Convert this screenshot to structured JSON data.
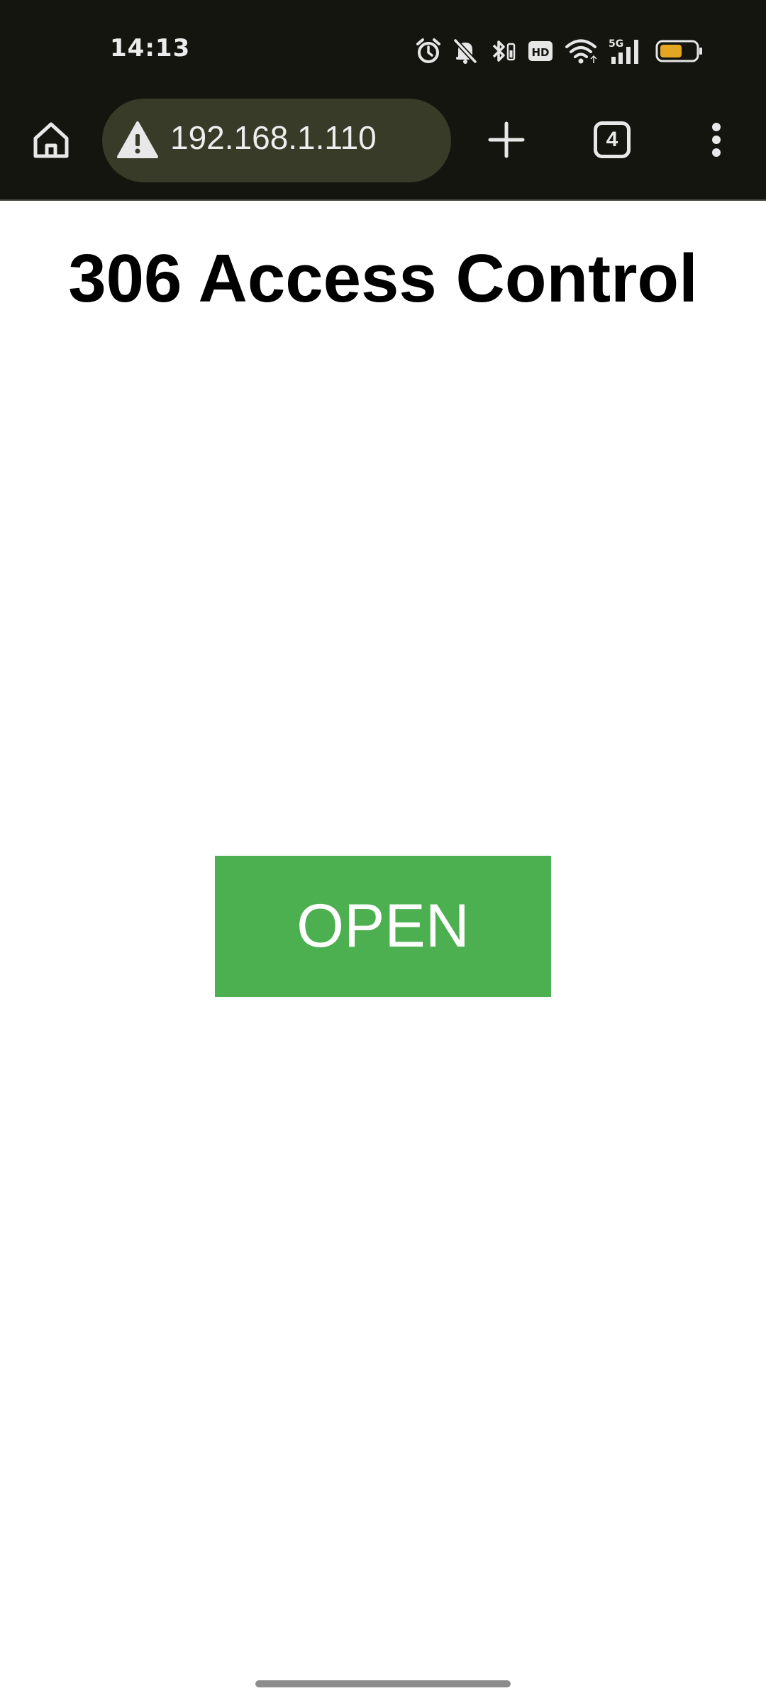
{
  "status_bar": {
    "time": "14:13",
    "network_label": "5G",
    "hd_label": "HD",
    "battery_color": "#e3a724",
    "icons": [
      "alarm-icon",
      "mute-bell-icon",
      "bluetooth-icon",
      "hd-voice-icon",
      "wifi-icon",
      "cellular-signal-icon",
      "battery-icon"
    ]
  },
  "browser": {
    "url": "192.168.1.110",
    "security_icon": "warning-icon",
    "tab_count": "4",
    "toolbar_icons": [
      "home-icon",
      "plus-icon",
      "tab-switcher-icon",
      "more-vert-icon"
    ]
  },
  "page": {
    "title": "306 Access Control",
    "open_button_label": "OPEN",
    "button_color": "#4caf50"
  }
}
